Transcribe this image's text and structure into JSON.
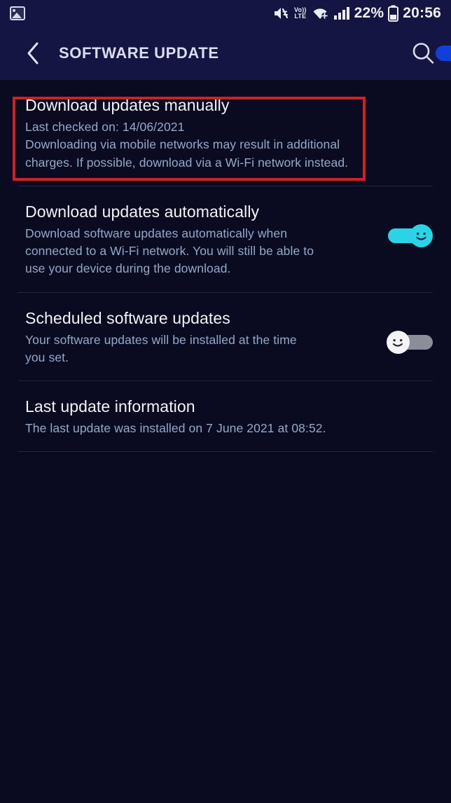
{
  "status_bar": {
    "notification_icon": "photo-icon",
    "mute_icon": "mute-icon",
    "volte_top": "Vo))",
    "volte_bottom": "LTE",
    "wifi_icon": "wifi-icon",
    "signal_icon": "signal-bars-icon",
    "battery_percent": "22%",
    "battery_icon": "battery-icon",
    "clock": "20:56"
  },
  "appbar": {
    "back_icon": "chevron-left-icon",
    "title": "SOFTWARE UPDATE",
    "search_icon": "search-icon",
    "accent_pill_color": "#1140d8"
  },
  "colors": {
    "background": "#0a0b20",
    "appbar": "#141543",
    "title_text": "#dcdcf0",
    "primary_text": "#f2f2f8",
    "secondary_text": "#93a9c9",
    "toggle_on": "#2ad4e6",
    "toggle_off_track": "#8b8d99",
    "toggle_off_knob": "#f4f4f7",
    "annotation_border": "#cc2127",
    "divider": "#22243f"
  },
  "settings": [
    {
      "id": "download-updates-manually",
      "title": "Download updates manually",
      "sub_lines": [
        "Last checked on: 14/06/2021",
        "Downloading via mobile networks may result in additional",
        "charges. If possible, download via a Wi-Fi network instead."
      ],
      "toggle": null
    },
    {
      "id": "download-updates-automatically",
      "title": "Download updates automatically",
      "sub_lines": [
        "Download software updates automatically when",
        "connected to a Wi-Fi network. You will still be able to",
        "use your device during the download."
      ],
      "toggle": "on"
    },
    {
      "id": "scheduled-software-updates",
      "title": "Scheduled software updates",
      "sub_lines": [
        "Your software updates will be installed at the time",
        "you set."
      ],
      "toggle": "off"
    },
    {
      "id": "last-update-information",
      "title": "Last update information",
      "sub_lines": [
        "The last update was installed on 7 June 2021 at 08:52."
      ],
      "toggle": null
    }
  ],
  "annotation": {
    "label": "highlight-box-download-updates-manually",
    "color": "#cc2127"
  }
}
